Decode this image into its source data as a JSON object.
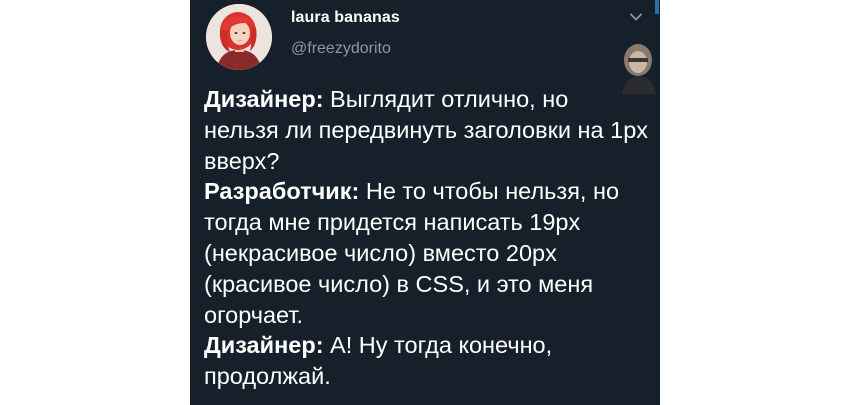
{
  "tweet": {
    "author_name": "laura bananas",
    "author_handle": "@freezydorito",
    "menu_icon": "chevron-down-icon",
    "avatar_icon": "avatar",
    "lines": [
      {
        "speaker": "Дизайнер:",
        "text": " Выглядит отлично, но нельзя ли передвинуть заголовки на 1px вверх?"
      },
      {
        "speaker": "Разработчик:",
        "text": " Не то чтобы нельзя, но тогда мне придется написать 19px (некрасивое число) вместо 20px (красивое число) в CSS, и это меня огорчает."
      },
      {
        "speaker": "Дизайнер:",
        "text": " А! Ну тогда конечно, продолжай."
      }
    ]
  },
  "colors": {
    "card_background": "#15202b",
    "name_text": "#ffffff",
    "handle_text": "#8899a6",
    "body_text": "#ffffff",
    "accent": "#2b6ea8"
  }
}
